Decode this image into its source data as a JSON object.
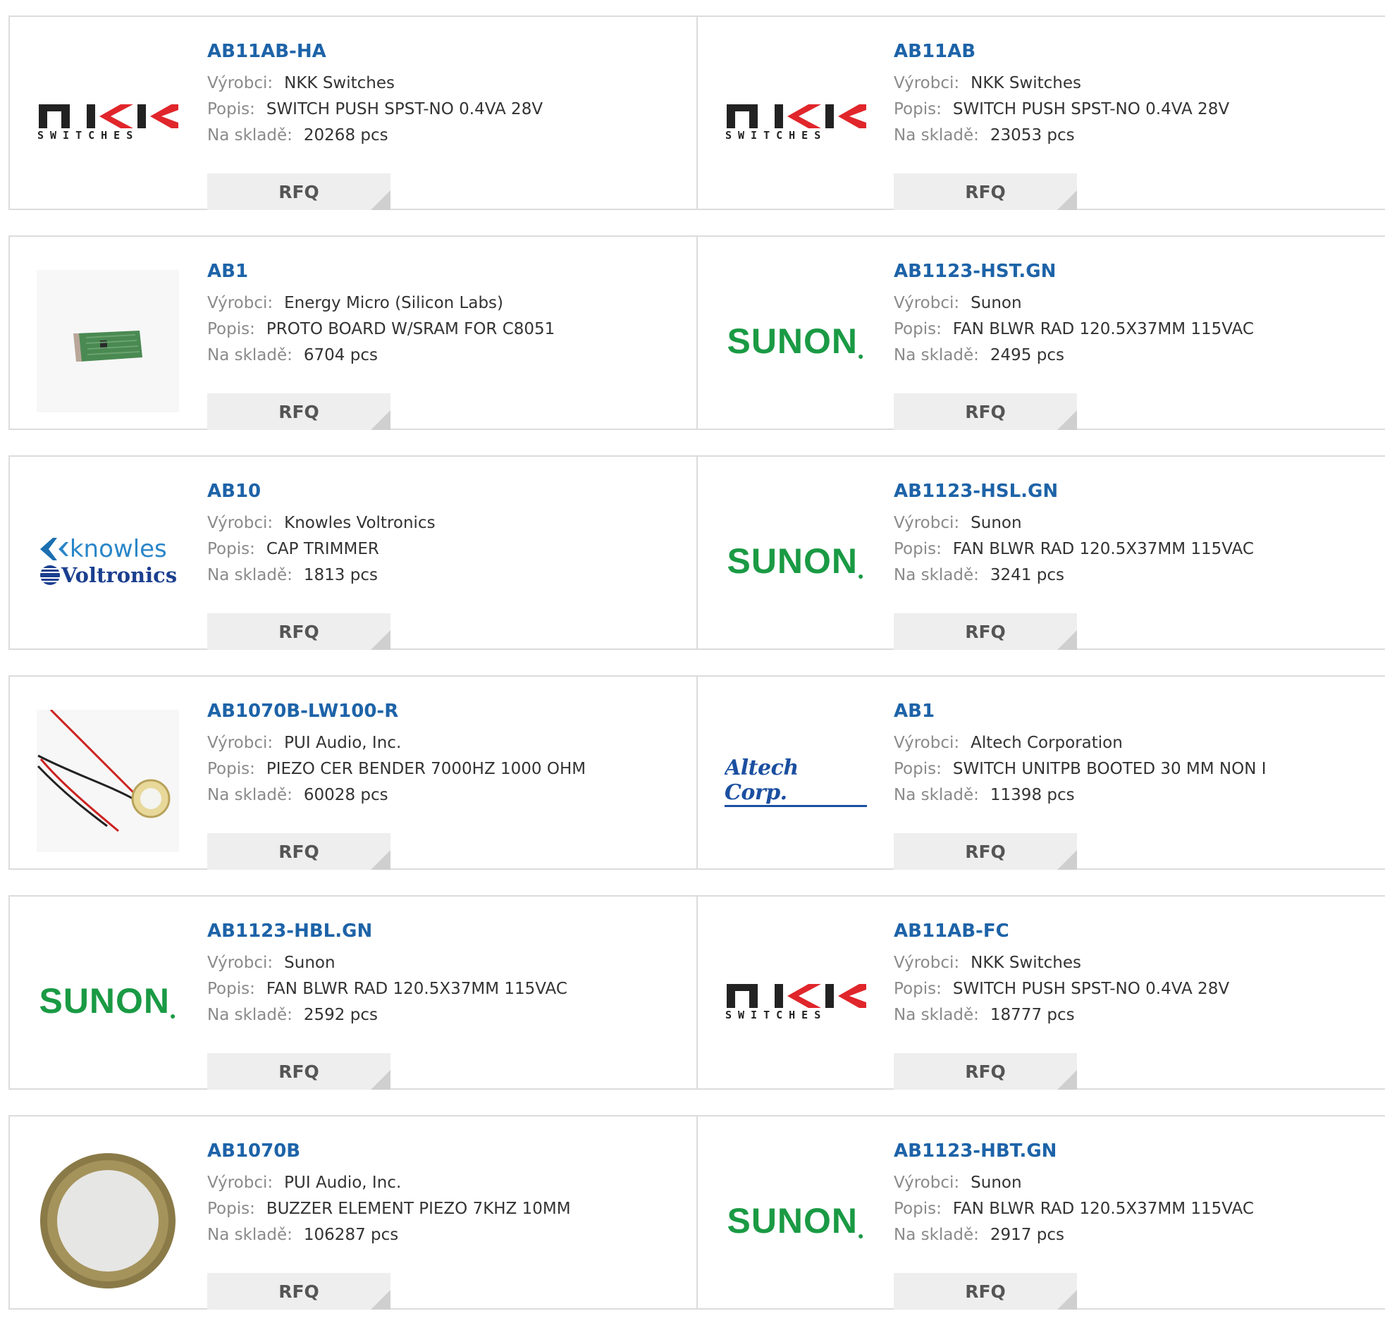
{
  "labels": {
    "manufacturer": "Výrobci:",
    "description": "Popis:",
    "stock": "Na skladě:",
    "rfq": "RFQ"
  },
  "rows": [
    {
      "left": {
        "part": "AB11AB-HA",
        "manufacturer": "NKK Switches",
        "description": "SWITCH PUSH SPST-NO 0.4VA 28V",
        "stock": "20268 pcs",
        "logo": "nkk-switches-logo"
      },
      "right": {
        "part": "AB11AB",
        "manufacturer": "NKK Switches",
        "description": "SWITCH PUSH SPST-NO 0.4VA 28V",
        "stock": "23053 pcs",
        "logo": "nkk-switches-logo"
      }
    },
    {
      "left": {
        "part": "AB1",
        "manufacturer": "Energy Micro (Silicon Labs)",
        "description": "PROTO BOARD W/SRAM FOR C8051",
        "stock": "6704 pcs",
        "logo": "proto-board-image"
      },
      "right": {
        "part": "AB1123-HST.GN",
        "manufacturer": "Sunon",
        "description": "FAN BLWR RAD 120.5X37MM 115VAC",
        "stock": "2495 pcs",
        "logo": "sunon-logo"
      }
    },
    {
      "left": {
        "part": "AB10",
        "manufacturer": "Knowles Voltronics",
        "description": "CAP TRIMMER",
        "stock": "1813 pcs",
        "logo": "knowles-voltronics-logo"
      },
      "right": {
        "part": "AB1123-HSL.GN",
        "manufacturer": "Sunon",
        "description": "FAN BLWR RAD 120.5X37MM 115VAC",
        "stock": "3241 pcs",
        "logo": "sunon-logo"
      }
    },
    {
      "left": {
        "part": "AB1070B-LW100-R",
        "manufacturer": "PUI Audio, Inc.",
        "description": "PIEZO CER BENDER 7000HZ 1000 OHM",
        "stock": "60028 pcs",
        "logo": "piezo-wire-image"
      },
      "right": {
        "part": "AB1",
        "manufacturer": "Altech Corporation",
        "description": "SWITCH UNITPB BOOTED 30 MM NON I",
        "stock": "11398 pcs",
        "logo": "altech-logo"
      }
    },
    {
      "left": {
        "part": "AB1123-HBL.GN",
        "manufacturer": "Sunon",
        "description": "FAN BLWR RAD 120.5X37MM 115VAC",
        "stock": "2592 pcs",
        "logo": "sunon-logo"
      },
      "right": {
        "part": "AB11AB-FC",
        "manufacturer": "NKK Switches",
        "description": "SWITCH PUSH SPST-NO 0.4VA 28V",
        "stock": "18777 pcs",
        "logo": "nkk-switches-logo"
      }
    },
    {
      "left": {
        "part": "AB1070B",
        "manufacturer": "PUI Audio, Inc.",
        "description": "BUZZER ELEMENT PIEZO 7KHZ 10MM",
        "stock": "106287 pcs",
        "logo": "piezo-disc-image"
      },
      "right": {
        "part": "AB1123-HBT.GN",
        "manufacturer": "Sunon",
        "description": "FAN BLWR RAD 120.5X37MM 115VAC",
        "stock": "2917 pcs",
        "logo": "sunon-logo"
      }
    }
  ],
  "logo_text": {
    "nkk_top": "NKK",
    "nkk_bottom": "SWITCHES",
    "sunon": "SUNON",
    "knowles": "knowles",
    "voltronics": "Voltronics",
    "altech": "Altech Corp."
  },
  "colors": {
    "part_link": "#1d63a8",
    "label": "#8a8a8a",
    "value": "#333333",
    "border": "#dcdcdc",
    "rfq_bg": "#eeeeee",
    "sunon_green": "#1a9a44",
    "nkk_red": "#e0262b",
    "altech_blue": "#1b4fa0"
  }
}
